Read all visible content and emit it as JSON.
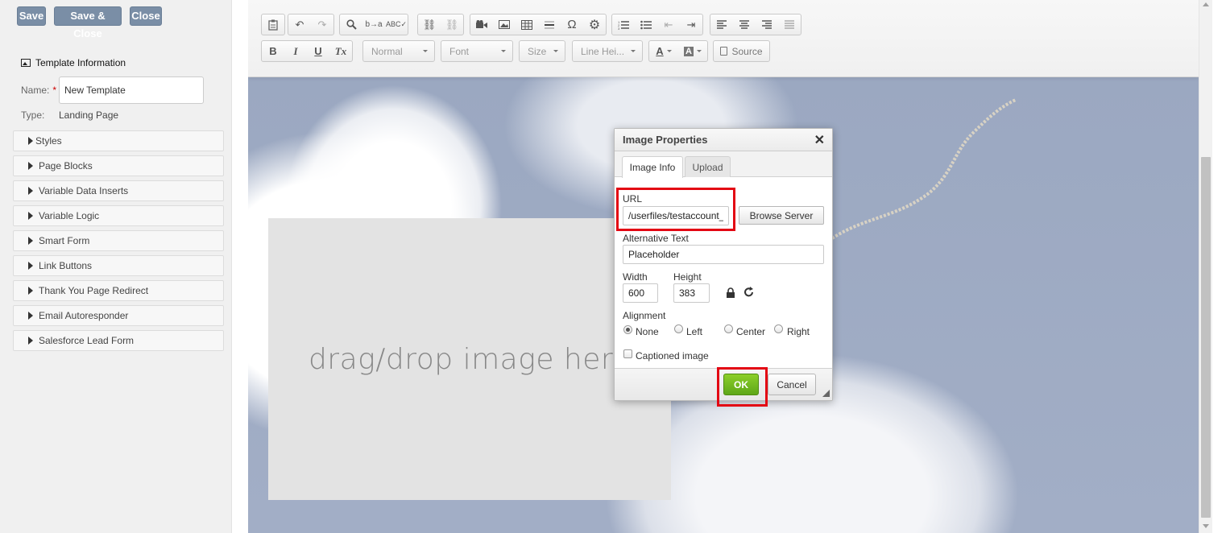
{
  "top_buttons": {
    "save": "Save",
    "save_close": "Save & Close",
    "close": "Close"
  },
  "template_info": {
    "heading": "Template Information",
    "name_label": "Name:",
    "required_mark": "*",
    "name_value": "New Template",
    "type_label": "Type:",
    "type_value": "Landing Page"
  },
  "accordion": [
    "Styles",
    "Page Blocks",
    "Variable Data Inserts",
    "Variable Logic",
    "Smart Form",
    "Link Buttons",
    "Thank You Page Redirect",
    "Email Autoresponder",
    "Salesforce Lead Form"
  ],
  "toolbar": {
    "format_combo": "Normal",
    "font_combo": "Font",
    "size_combo": "Size",
    "line_height_combo": "Line Hei...",
    "source_label": "Source",
    "bold": "B",
    "italic": "I",
    "underline": "U",
    "remove_format": "Tx",
    "text_color": "A",
    "bg_color": "A",
    "special_char": "Ω"
  },
  "canvas": {
    "dropzone_text": "drag/drop image here"
  },
  "dialog": {
    "title": "Image Properties",
    "close": "✕",
    "tabs": [
      "Image Info",
      "Upload"
    ],
    "url_label": "URL",
    "url_value": "/userfiles/testaccount_",
    "browse_label": "Browse Server",
    "alt_label": "Alternative Text",
    "alt_value": "Placeholder",
    "width_label": "Width",
    "width_value": "600",
    "height_label": "Height",
    "height_value": "383",
    "alignment_label": "Alignment",
    "alignment_options": [
      "None",
      "Left",
      "Center",
      "Right"
    ],
    "alignment_selected": "None",
    "captioned_label": "Captioned image",
    "ok_label": "OK",
    "cancel_label": "Cancel"
  },
  "colors": {
    "highlight": "#e30613",
    "ok_green": "#6cb61f",
    "button_blue": "#7a8ea6"
  }
}
